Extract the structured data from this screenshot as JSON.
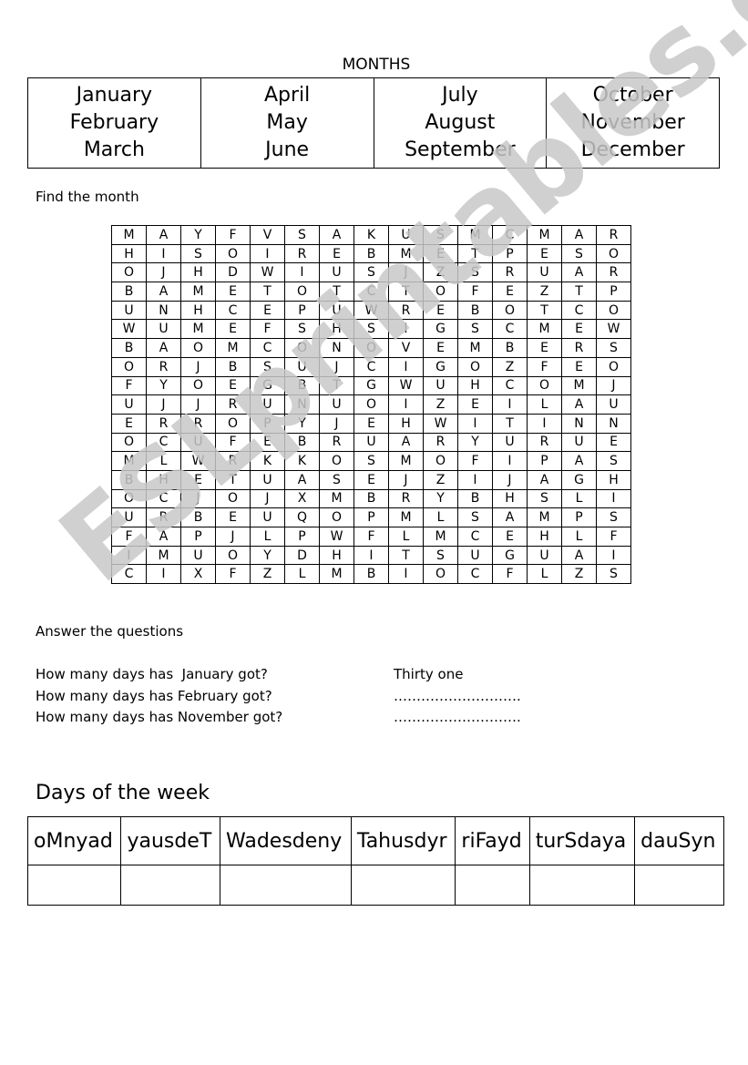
{
  "months_section": {
    "title": "MONTHS",
    "columns": [
      [
        "January",
        "February",
        "March"
      ],
      [
        "April",
        "May",
        "June"
      ],
      [
        "July",
        "August",
        "September"
      ],
      [
        "October",
        "November",
        "December"
      ]
    ]
  },
  "word_search": {
    "instruction": "Find the month",
    "rows": [
      [
        "M",
        "A",
        "Y",
        "F",
        "V",
        "S",
        "A",
        "K",
        "U",
        "S",
        "M",
        "C",
        "M",
        "A",
        "R"
      ],
      [
        "H",
        "I",
        "S",
        "O",
        "I",
        "R",
        "E",
        "B",
        "M",
        "E",
        "T",
        "P",
        "E",
        "S",
        "O"
      ],
      [
        "O",
        "J",
        "H",
        "D",
        "W",
        "I",
        "U",
        "S",
        "J",
        "Z",
        "S",
        "R",
        "U",
        "A",
        "R"
      ],
      [
        "B",
        "A",
        "M",
        "E",
        "T",
        "O",
        "T",
        "C",
        "T",
        "O",
        "F",
        "E",
        "Z",
        "T",
        "P"
      ],
      [
        "U",
        "N",
        "H",
        "C",
        "E",
        "P",
        "U",
        "W",
        "R",
        "E",
        "B",
        "O",
        "T",
        "C",
        "O"
      ],
      [
        "W",
        "U",
        "M",
        "E",
        "F",
        "S",
        "H",
        "S",
        "I",
        "G",
        "S",
        "C",
        "M",
        "E",
        "W"
      ],
      [
        "B",
        "A",
        "O",
        "M",
        "C",
        "O",
        "N",
        "O",
        "V",
        "E",
        "M",
        "B",
        "E",
        "R",
        "S"
      ],
      [
        "O",
        "R",
        "J",
        "B",
        "S",
        "U",
        "J",
        "C",
        "I",
        "G",
        "O",
        "Z",
        "F",
        "E",
        "O"
      ],
      [
        "F",
        "Y",
        "O",
        "E",
        "G",
        "B",
        "T",
        "G",
        "W",
        "U",
        "H",
        "C",
        "O",
        "M",
        "J"
      ],
      [
        "U",
        "J",
        "J",
        "R",
        "U",
        "N",
        "U",
        "O",
        "I",
        "Z",
        "E",
        "I",
        "L",
        "A",
        "U"
      ],
      [
        "E",
        "R",
        "R",
        "O",
        "P",
        "Y",
        "J",
        "E",
        "H",
        "W",
        "I",
        "T",
        "I",
        "N",
        "N"
      ],
      [
        "O",
        "C",
        "U",
        "F",
        "E",
        "B",
        "R",
        "U",
        "A",
        "R",
        "Y",
        "U",
        "R",
        "U",
        "E"
      ],
      [
        "M",
        "L",
        "W",
        "R",
        "K",
        "K",
        "O",
        "S",
        "M",
        "O",
        "F",
        "I",
        "P",
        "A",
        "S"
      ],
      [
        "B",
        "H",
        "E",
        "T",
        "U",
        "A",
        "S",
        "E",
        "J",
        "Z",
        "I",
        "J",
        "A",
        "G",
        "H"
      ],
      [
        "O",
        "C",
        "J",
        "O",
        "J",
        "X",
        "M",
        "B",
        "R",
        "Y",
        "B",
        "H",
        "S",
        "L",
        "I"
      ],
      [
        "U",
        "R",
        "B",
        "E",
        "U",
        "Q",
        "O",
        "P",
        "M",
        "L",
        "S",
        "A",
        "M",
        "P",
        "S"
      ],
      [
        "F",
        "A",
        "P",
        "J",
        "L",
        "P",
        "W",
        "F",
        "L",
        "M",
        "C",
        "E",
        "H",
        "L",
        "F"
      ],
      [
        "I",
        "M",
        "U",
        "O",
        "Y",
        "D",
        "H",
        "I",
        "T",
        "S",
        "U",
        "G",
        "U",
        "A",
        "I"
      ],
      [
        "C",
        "I",
        "X",
        "F",
        "Z",
        "L",
        "M",
        "B",
        "I",
        "O",
        "C",
        "F",
        "L",
        "Z",
        "S"
      ]
    ]
  },
  "questions_section": {
    "instruction": "Answer the questions",
    "items": [
      {
        "question": "How many days has  January got?",
        "answer": "Thirty one"
      },
      {
        "question": "How many days has February got?",
        "answer": "………………………."
      },
      {
        "question": "How many days has November got?",
        "answer": "………………………."
      }
    ]
  },
  "days_section": {
    "title": "Days of the week",
    "scrambled": [
      "oMnyad",
      "yausdeT",
      "Wadesdeny",
      "Tahusdyr",
      "riFayd",
      "turSdaya",
      "dauSyn"
    ],
    "answers": [
      "",
      "",
      "",
      "",
      "",
      "",
      ""
    ]
  },
  "watermark": {
    "text": "ESLprintables.com",
    "color": "#c8c8c8"
  }
}
